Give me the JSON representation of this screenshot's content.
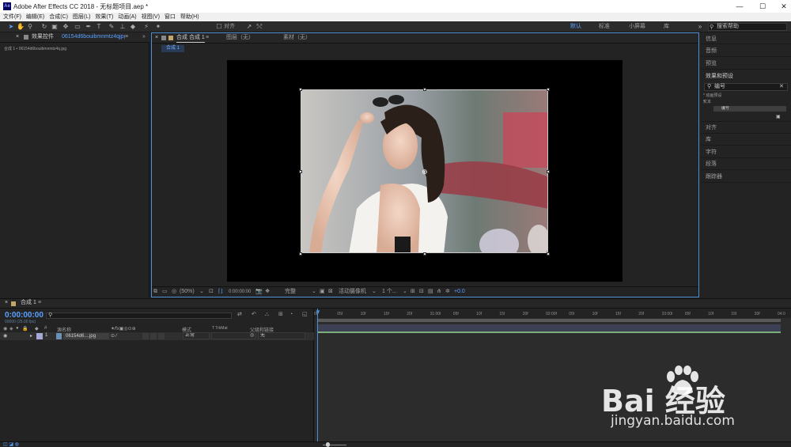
{
  "window": {
    "title": "Adobe After Effects CC 2018 - 无标题项目.aep *",
    "logo_text": "Ae",
    "minimize": "—",
    "maximize": "☐",
    "close": "✕"
  },
  "menu": [
    "文件(F)",
    "编辑(E)",
    "合成(C)",
    "图层(L)",
    "效果(T)",
    "动画(A)",
    "视图(V)",
    "窗口",
    "帮助(H)"
  ],
  "toolbar": {
    "align_label": "对齐",
    "workspaces": [
      "默认",
      "标准",
      "小屏幕",
      "库"
    ],
    "active_workspace": "默认",
    "search_placeholder": "搜索帮助"
  },
  "left_panel": {
    "tab_prefix": "效果控件",
    "tab_file": "06154d6bouibmnmtz4qjpg",
    "row": "合成 1 • 06154d6bouibmnmtz4q.jpg"
  },
  "comp_panel": {
    "tab_comp": "合成 合成 1",
    "tab_layer": "图层（无）",
    "tab_footage": "素材（无）",
    "subtab": "合成 1",
    "zoom": "(50%)",
    "timecode": "0:00:00:00",
    "resolution": "完整",
    "camera": "活动摄像机",
    "views": "1 个...",
    "exposure": "+0.0"
  },
  "right_panel": {
    "items_top": [
      "信息",
      "音频",
      "预览",
      "效果和预设"
    ],
    "fx_search_value": "编号",
    "tree_presets": "* 动画预设",
    "tree_text": "文本",
    "tree_number": "编号",
    "items_bottom": [
      "对齐",
      "库",
      "字符",
      "段落",
      "跟踪器"
    ]
  },
  "timeline": {
    "tab": "合成 1",
    "timecode": "0:00:00:00",
    "framerate": "00000 (25.00 fps)",
    "col_name": "源名称",
    "col_mode": "模式",
    "col_trkmat": "T  TrkMat",
    "col_parent": "父级和链接",
    "layer_index": "1",
    "layer_name": "06154d6....jpg",
    "layer_mode": "正常",
    "layer_parent": "无",
    "ruler": [
      "0f",
      "05f",
      "10f",
      "15f",
      "20f",
      "01:00f",
      "05f",
      "10f",
      "15f",
      "20f",
      "02:00f",
      "05f",
      "10f",
      "15f",
      "20f",
      "03:00f",
      "05f",
      "10f",
      "15f",
      "20f",
      "04:0"
    ]
  },
  "watermark": {
    "brand": "Bai  经验",
    "url": "jingyan.baidu.com"
  },
  "colors": {
    "accent": "#4a90d9",
    "panel": "#232323",
    "timeline_track": "#3d3f55"
  }
}
